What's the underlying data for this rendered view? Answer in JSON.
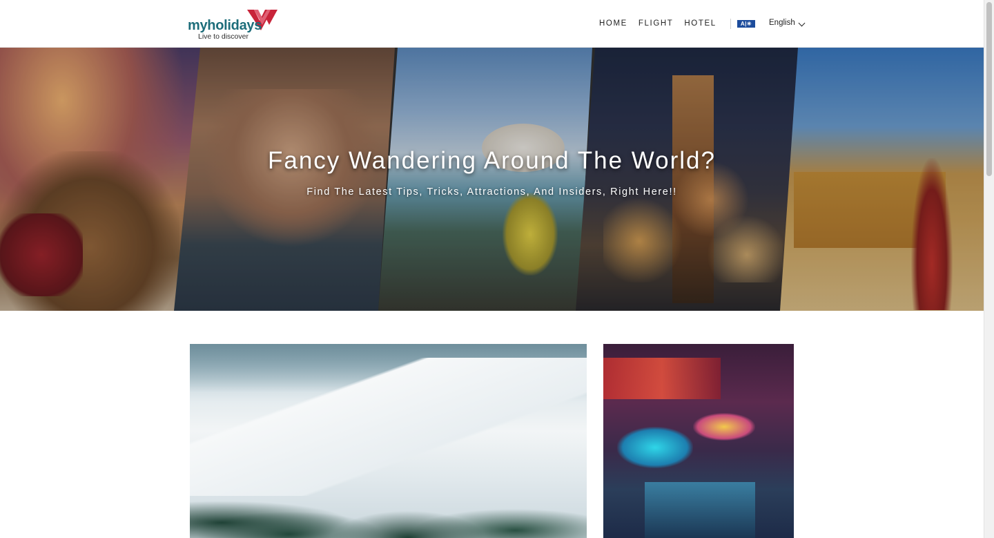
{
  "header": {
    "logo": {
      "brand": "myholidays",
      "tagline": "Live to discover"
    },
    "nav": [
      {
        "label": "HOME"
      },
      {
        "label": "FLIGHT"
      },
      {
        "label": "HOTEL"
      }
    ],
    "language": {
      "flag_text": "A|✳",
      "label": "English"
    }
  },
  "hero": {
    "title": "Fancy Wandering Around The World?",
    "subtitle": "Find The Latest Tips, Tricks, Attractions, And Insiders, Right Here!!"
  },
  "colors": {
    "brand_teal": "#1d6d7a",
    "brand_red": "#c8243a",
    "flag_blue": "#1c4c9c"
  }
}
